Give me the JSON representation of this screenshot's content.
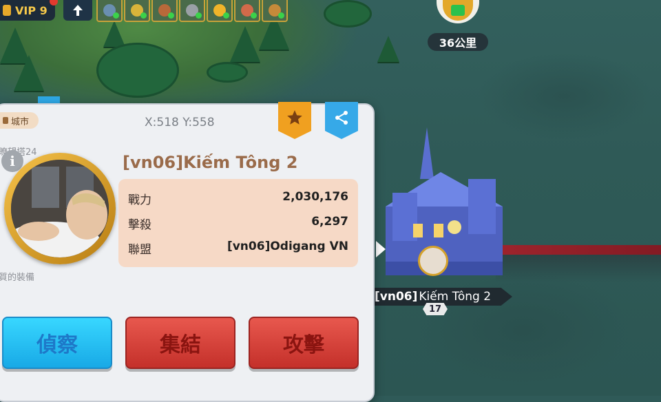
{
  "top_bar": {
    "vip_label": "VIP 9",
    "buff_icons": [
      "buff-shield-icon",
      "buff-food-icon",
      "buff-wood-icon",
      "buff-stone-icon",
      "buff-gold-icon",
      "buff-speed-icon",
      "buff-troop-icon"
    ]
  },
  "target_marker": {
    "distance": "36公里"
  },
  "panel": {
    "city_tag": "城市",
    "coords": "X:518 Y:558",
    "faded_left_top": "瞭望塔24",
    "faded_left_bottom": "質的裝備",
    "player_name": "[vn06]Kiếm Tông 2",
    "stats": [
      {
        "label": "戰力",
        "value": "2,030,176"
      },
      {
        "label": "擊殺",
        "value": "6,297"
      },
      {
        "label": "聯盟",
        "value": "[vn06]Odigang VN"
      }
    ],
    "buttons": {
      "scout": "偵察",
      "rally": "集結",
      "attack": "攻擊"
    }
  },
  "castle": {
    "alliance_tag": "[vn06]",
    "name": "Kiếm Tông 2",
    "level": "17"
  },
  "colors": {
    "panel_bg": "#eef0f3",
    "stats_bg": "#f6d9c6",
    "scout_button": "#18a9e6",
    "action_button": "#c4302a",
    "name_text": "#9a6b4a"
  }
}
